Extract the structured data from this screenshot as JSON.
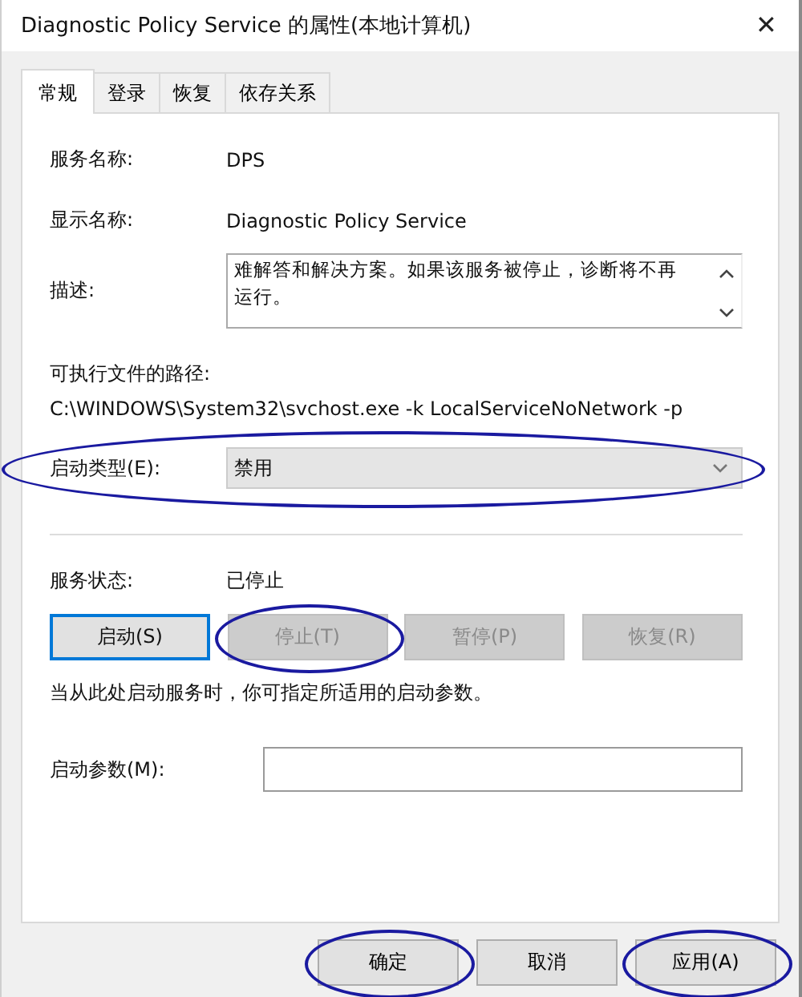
{
  "window": {
    "title": "Diagnostic Policy Service 的属性(本地计算机)",
    "close": "✕"
  },
  "tabs": [
    {
      "label": "常规",
      "selected": true
    },
    {
      "label": "登录",
      "selected": false
    },
    {
      "label": "恢复",
      "selected": false
    },
    {
      "label": "依存关系",
      "selected": false
    }
  ],
  "service_name": {
    "label": "服务名称:",
    "value": "DPS"
  },
  "display_name": {
    "label": "显示名称:",
    "value": "Diagnostic Policy Service"
  },
  "description": {
    "label": "描述:",
    "value": "难解答和解决方案。如果该服务被停止，诊断将不再运行。"
  },
  "executable_path": {
    "label": "可执行文件的路径:",
    "value": "C:\\WINDOWS\\System32\\svchost.exe -k LocalServiceNoNetwork -p"
  },
  "startup_type": {
    "label": "启动类型(E):",
    "value": "禁用",
    "disabled": true,
    "circled": true
  },
  "service_status": {
    "label": "服务状态:",
    "value": "已停止"
  },
  "control_buttons": [
    {
      "label": "启动(S)",
      "disabled": false,
      "focused": true,
      "circled": false
    },
    {
      "label": "停止(T)",
      "disabled": true,
      "focused": false,
      "circled": true
    },
    {
      "label": "暂停(P)",
      "disabled": true,
      "focused": false,
      "circled": false
    },
    {
      "label": "恢复(R)",
      "disabled": true,
      "focused": false,
      "circled": false
    }
  ],
  "hint": "当从此处启动服务时，你可指定所适用的启动参数。",
  "start_parameters": {
    "label": "启动参数(M):"
  },
  "dialog_buttons": [
    {
      "label": "确定",
      "circled": true
    },
    {
      "label": "取消",
      "circled": false
    },
    {
      "label": "应用(A)",
      "circled": true
    }
  ]
}
